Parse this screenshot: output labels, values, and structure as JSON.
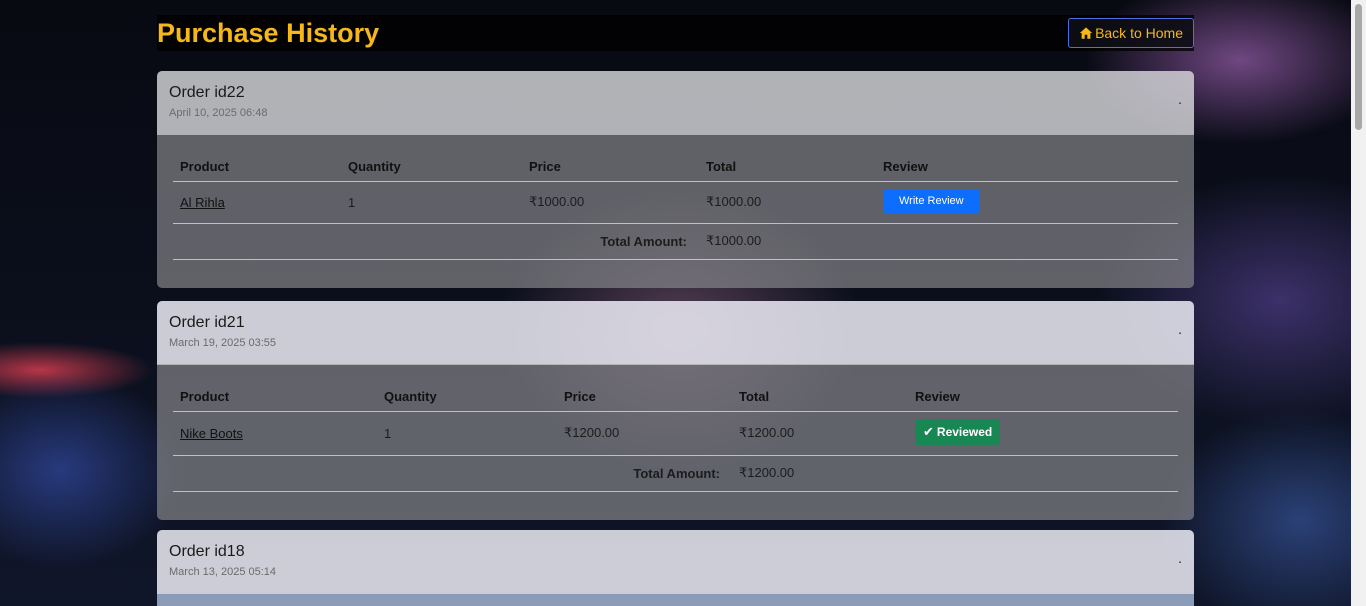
{
  "header": {
    "title": "Purchase History",
    "back_button": "Back to Home",
    "back_icon": "home-icon"
  },
  "table_headers": {
    "product": "Product",
    "quantity": "Quantity",
    "price": "Price",
    "total": "Total",
    "review": "Review"
  },
  "total_amount_label": "Total Amount:",
  "orders": [
    {
      "title": "Order id22",
      "date": "April 10, 2025 06:48",
      "dot": ".",
      "items": [
        {
          "product": "Al Rihla",
          "quantity": "1",
          "price": "₹1000.00",
          "total": "₹1000.00",
          "review": "Write Review"
        }
      ],
      "total_amount": "₹1000.00"
    },
    {
      "title": "Order id21",
      "date": "March 19, 2025 03:55",
      "dot": ".",
      "items": [
        {
          "product": "Nike Boots",
          "quantity": "1",
          "price": "₹1200.00",
          "total": "₹1200.00",
          "review": "Reviewed"
        }
      ],
      "total_amount": "₹1200.00"
    },
    {
      "title": "Order id18",
      "date": "March 13, 2025 05:14",
      "dot": "."
    }
  ],
  "colors": {
    "title": "#f5b818",
    "write_review_button": "#0d6efd",
    "reviewed_badge": "#198754"
  }
}
